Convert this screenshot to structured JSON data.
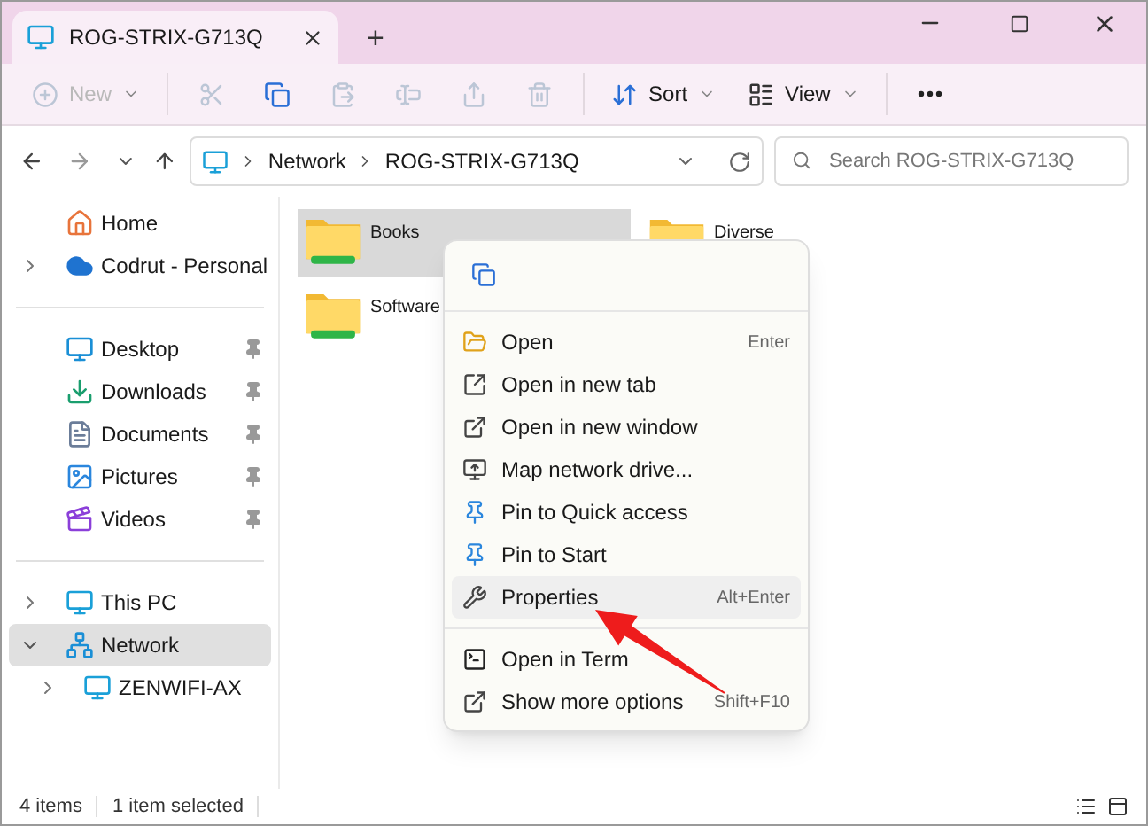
{
  "tab": {
    "title": "ROG-STRIX-G713Q"
  },
  "new_tab_button": "+",
  "toolbar": {
    "buttons": [
      {
        "kind": "new",
        "label": "New",
        "disabled": true
      },
      {
        "kind": "cut",
        "disabled": true
      },
      {
        "kind": "copy",
        "disabled": false
      },
      {
        "kind": "paste",
        "disabled": true
      },
      {
        "kind": "rename",
        "disabled": true
      },
      {
        "kind": "share",
        "disabled": true
      },
      {
        "kind": "delete",
        "disabled": true
      },
      {
        "kind": "sort",
        "label": "Sort",
        "disabled": false
      },
      {
        "kind": "view",
        "label": "View",
        "disabled": false
      },
      {
        "kind": "more",
        "disabled": false
      }
    ]
  },
  "address_bar": {
    "path": [
      "Network",
      "ROG-STRIX-G713Q"
    ]
  },
  "search": {
    "placeholder": "Search ROG-STRIX-G713Q"
  },
  "navigation": {
    "groups": [
      [
        {
          "label": "Home",
          "kind": "home",
          "selected": false
        },
        {
          "label": "Codrut - Personal",
          "kind": "cloud",
          "expanded": false,
          "selected": false
        }
      ],
      [
        {
          "label": "Desktop",
          "kind": "desktop",
          "pinned": true,
          "selected": false
        },
        {
          "label": "Downloads",
          "kind": "downloads",
          "pinned": true,
          "selected": false
        },
        {
          "label": "Documents",
          "kind": "documents",
          "pinned": true,
          "selected": false
        },
        {
          "label": "Pictures",
          "kind": "pictures",
          "pinned": true,
          "selected": false
        },
        {
          "label": "Videos",
          "kind": "videos",
          "pinned": true,
          "selected": false
        }
      ],
      [
        {
          "label": "This PC",
          "kind": "pc",
          "expanded": false,
          "selected": false
        },
        {
          "label": "Network",
          "kind": "network",
          "expanded": true,
          "selected": true,
          "children": [
            {
              "label": "ZENWIFI-AX",
              "kind": "pc",
              "expanded": false,
              "selected": false
            }
          ]
        }
      ]
    ]
  },
  "files": [
    {
      "name": "Books",
      "selected": true
    },
    {
      "name": "Diverse",
      "selected": false
    },
    {
      "name": "Software",
      "selected": false
    }
  ],
  "context_menu": {
    "groups": [
      [
        {
          "kind": "copy",
          "selected": false
        }
      ],
      [
        {
          "kind": "open",
          "label": "Open",
          "shortcut": "Enter",
          "selected": false
        },
        {
          "kind": "new-tab",
          "label": "Open in new tab",
          "selected": false
        },
        {
          "kind": "new-window",
          "label": "Open in new window",
          "selected": false
        },
        {
          "kind": "map-drive",
          "label": "Map network drive...",
          "selected": false
        },
        {
          "kind": "pin",
          "label": "Pin to Quick access",
          "selected": false
        },
        {
          "kind": "pin",
          "label": "Pin to Start",
          "selected": false
        },
        {
          "kind": "properties",
          "label": "Properties",
          "shortcut": "Alt+Enter",
          "selected": true
        }
      ],
      [
        {
          "kind": "terminal",
          "label": "Open in Term",
          "selected": false
        },
        {
          "kind": "more-options",
          "label": "Show more options",
          "shortcut": "Shift+F10",
          "selected": false
        }
      ]
    ]
  },
  "status_bar": {
    "count": "4 items",
    "selection": "1 item selected"
  }
}
